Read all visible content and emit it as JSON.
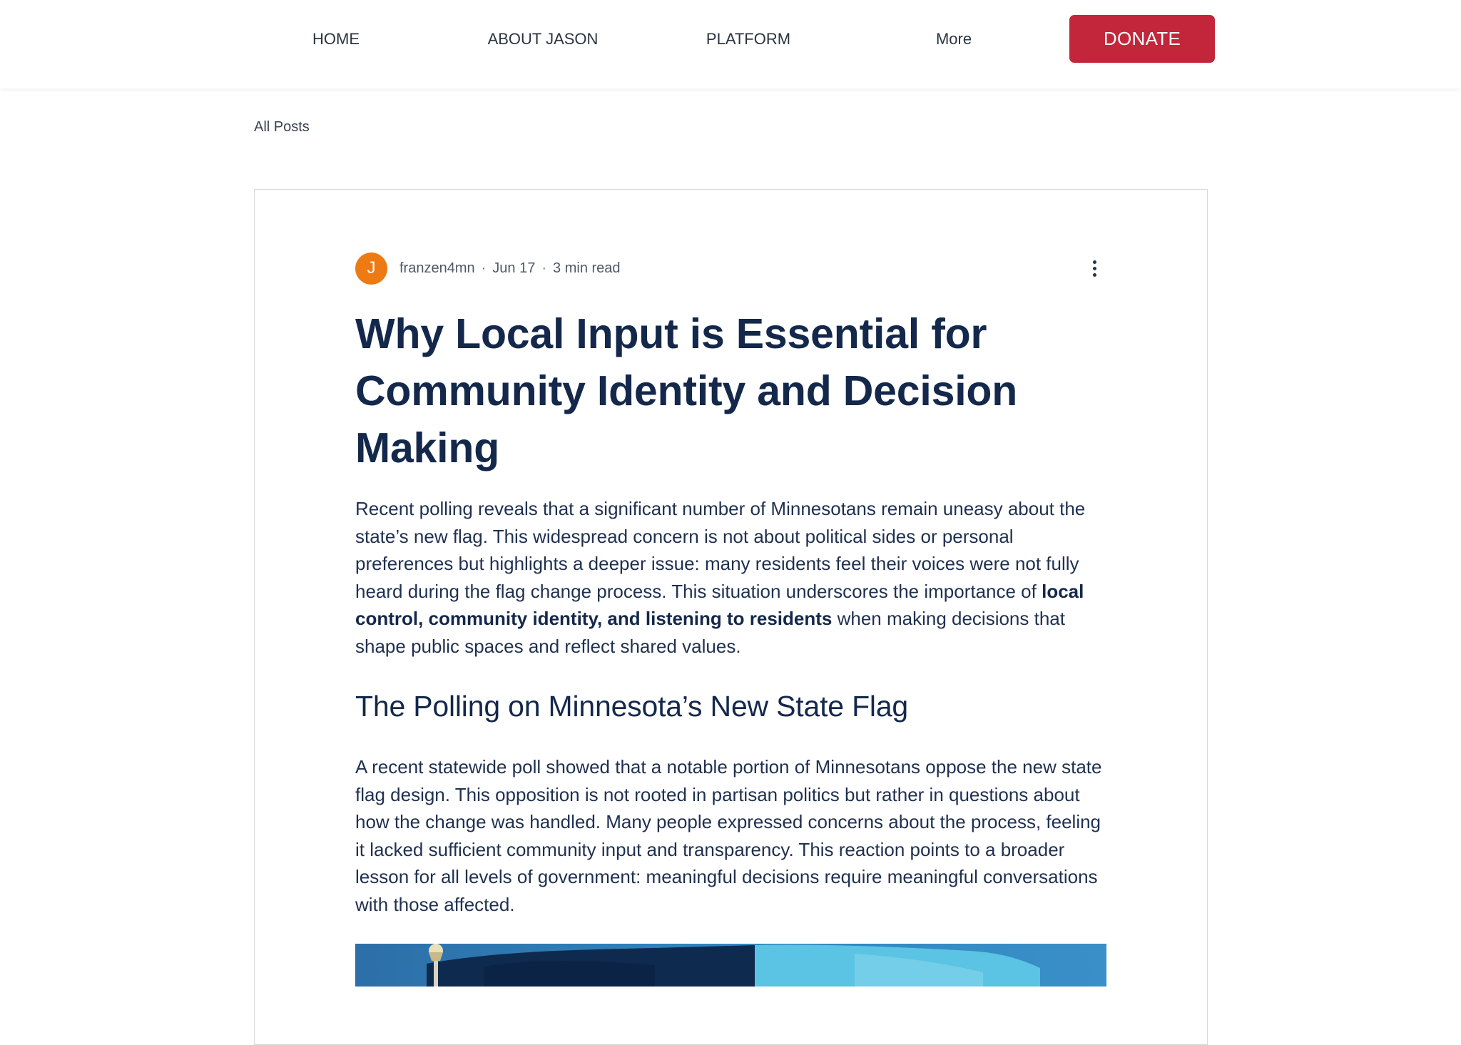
{
  "header": {
    "nav": [
      {
        "label": "HOME"
      },
      {
        "label": "ABOUT JASON"
      },
      {
        "label": "PLATFORM"
      },
      {
        "label": "More"
      }
    ],
    "donate_label": "DONATE",
    "donate_color": "#c3263a"
  },
  "breadcrumb": {
    "all_posts": "All Posts"
  },
  "post": {
    "avatar_initial": "J",
    "avatar_color": "#ee7a14",
    "author": "franzen4mn",
    "separator": "·",
    "date": "Jun 17",
    "read_time": "3 min read",
    "more_actions_icon": "vertical-dots-icon",
    "title": "Why Local Input is Essential for Community Identity and Decision Making",
    "intro_part1": "Recent polling reveals that a significant number of Minnesotans remain uneasy about the state’s new flag. This widespread concern is not about political sides or personal preferences but highlights a deeper issue: many residents feel their voices were not fully heard during the flag change process. This situation underscores the importance of ",
    "intro_bold": "local control, community identity, and listening to residents",
    "intro_part2": " when making decisions that shape public spaces and reflect shared values.",
    "section_heading": "The Polling on Minnesota’s New State Flag",
    "section_paragraph": "A recent statewide poll showed that a notable portion of Minnesotans oppose the new state flag design. This opposition is not rooted in partisan politics but rather in questions about how the change was handled. Many people expressed concerns about the process, feeling it lacked sufficient community input and transparency. This reaction points to a broader lesson for all levels of government: meaningful decisions require meaningful conversations with those affected."
  }
}
